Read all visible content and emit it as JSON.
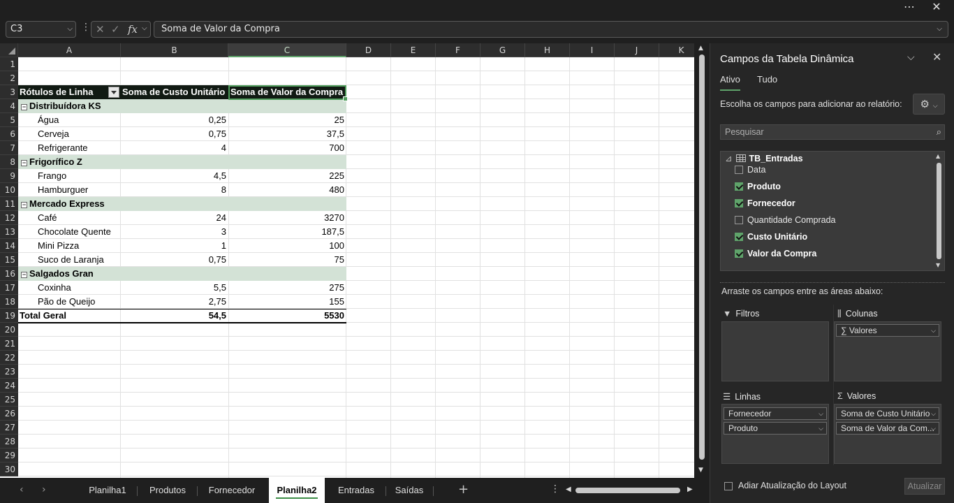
{
  "window": {
    "more_icon": "more-options-icon",
    "close_icon": "close-icon"
  },
  "formula_bar": {
    "name_box": "C3",
    "formula": "Soma de Valor da Compra"
  },
  "grid": {
    "columns": [
      "A",
      "B",
      "C",
      "D",
      "E",
      "F",
      "G",
      "H",
      "I",
      "J",
      "K"
    ],
    "selected_column": "C",
    "rows": [
      "1",
      "2",
      "3",
      "4",
      "5",
      "6",
      "7",
      "8",
      "9",
      "10",
      "11",
      "12",
      "13",
      "14",
      "15",
      "16",
      "17",
      "18",
      "19",
      "20",
      "21",
      "22",
      "23",
      "24",
      "25",
      "26",
      "27",
      "28",
      "29",
      "30"
    ],
    "pivot": {
      "headers": [
        "Rótulos de Linha",
        "Soma de Custo Unitário",
        "Soma de Valor da Compra"
      ],
      "groups": [
        {
          "name": "Distribuídora KS",
          "items": [
            {
              "label": "Água",
              "cost": "0,25",
              "value": "25"
            },
            {
              "label": "Cerveja",
              "cost": "0,75",
              "value": "37,5"
            },
            {
              "label": "Refrigerante",
              "cost": "4",
              "value": "700"
            }
          ]
        },
        {
          "name": "Frigorífico Z",
          "items": [
            {
              "label": "Frango",
              "cost": "4,5",
              "value": "225"
            },
            {
              "label": "Hamburguer",
              "cost": "8",
              "value": "480"
            }
          ]
        },
        {
          "name": "Mercado Express",
          "items": [
            {
              "label": "Café",
              "cost": "24",
              "value": "3270"
            },
            {
              "label": "Chocolate Quente",
              "cost": "3",
              "value": "187,5"
            },
            {
              "label": "Mini Pizza",
              "cost": "1",
              "value": "100"
            },
            {
              "label": "Suco de Laranja",
              "cost": "0,75",
              "value": "75"
            }
          ]
        },
        {
          "name": "Salgados Gran",
          "items": [
            {
              "label": "Coxinha",
              "cost": "5,5",
              "value": "275"
            },
            {
              "label": "Pão de Queijo",
              "cost": "2,75",
              "value": "155"
            }
          ]
        }
      ],
      "total": {
        "label": "Total Geral",
        "cost": "54,5",
        "value": "5530"
      }
    }
  },
  "sheet_tabs": {
    "tabs": [
      "Planilha1",
      "Produtos",
      "Fornecedor",
      "Planilha2",
      "Entradas",
      "Saídas"
    ],
    "active": "Planilha2"
  },
  "pivot_panel": {
    "title": "Campos da Tabela Dinâmica",
    "tabs": [
      "Ativo",
      "Tudo"
    ],
    "choose_label": "Escolha os campos para adicionar ao relatório:",
    "search_placeholder": "Pesquisar",
    "table_name": "TB_Entradas",
    "fields": [
      {
        "name": "Data",
        "checked": false
      },
      {
        "name": "Produto",
        "checked": true
      },
      {
        "name": "Fornecedor",
        "checked": true
      },
      {
        "name": "Quantidade Comprada",
        "checked": false
      },
      {
        "name": "Custo Unitário",
        "checked": true
      },
      {
        "name": "Valor da Compra",
        "checked": true
      }
    ],
    "drag_label": "Arraste os campos entre as áreas abaixo:",
    "areas": {
      "filters": {
        "label": "Filtros",
        "items": []
      },
      "columns": {
        "label": "Colunas",
        "items": [
          "∑ Valores"
        ]
      },
      "rows": {
        "label": "Linhas",
        "items": [
          "Fornecedor",
          "Produto"
        ]
      },
      "values": {
        "label": "Valores",
        "items": [
          "Soma de Custo Unitário",
          "Soma de Valor da Com..."
        ]
      }
    },
    "defer_label": "Adiar Atualização do Layout",
    "update_label": "Atualizar"
  }
}
